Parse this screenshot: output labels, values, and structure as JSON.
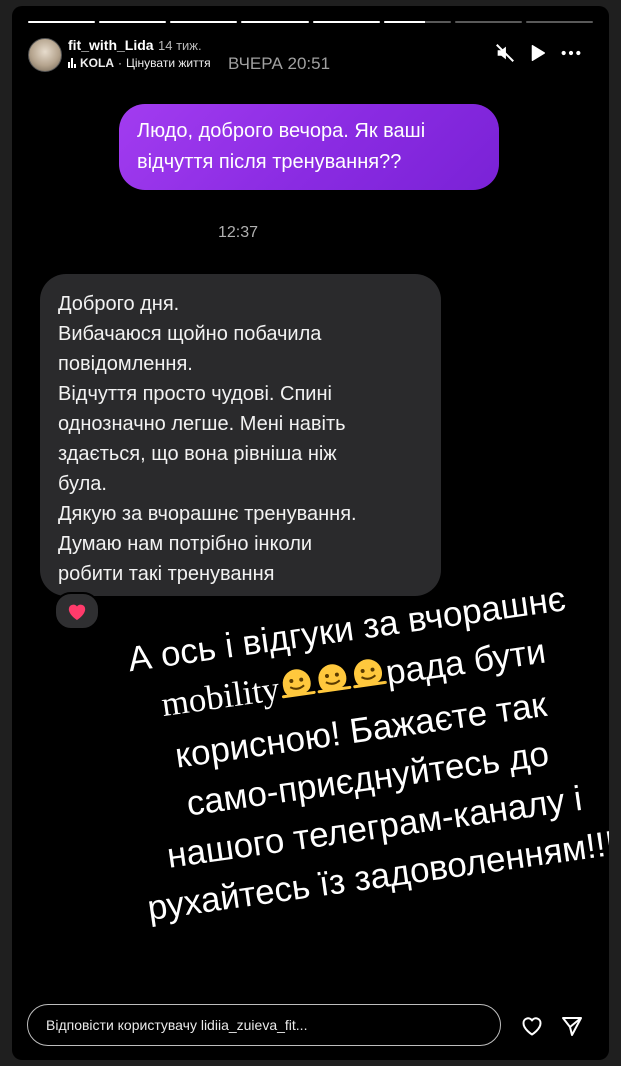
{
  "story": {
    "progress_segments": [
      1,
      1,
      1,
      1,
      1,
      0.62,
      0,
      0
    ],
    "username": "fit_with_Lida",
    "time_ago": "14 тиж.",
    "music": {
      "artist": "KOLA",
      "separator": "·",
      "song": "Цінувати життя"
    },
    "icons": {
      "mute": "muted-speaker-icon",
      "play": "play-icon",
      "more": "more-dots-icon"
    }
  },
  "chat": {
    "date_header": "ВЧЕРА 20:51",
    "outgoing": "Людо, доброго вечора.  Як ваші відчуття після тренування??",
    "time": "12:37",
    "incoming_lines": [
      "Доброго дня.",
      "Вибачаюся щойно побачила",
      "повідомлення.",
      "Відчуття просто чудові. Спині",
      "однозначно легше. Мені навіть",
      "здається, що вона рівніша ніж",
      "була.",
      "Дякую за вчорашнє тренування.",
      "Думаю нам потрібно інколи",
      "робити такі тренування"
    ],
    "reaction": "heart-reaction-icon"
  },
  "caption": {
    "line1": "А ось і відгуки за вчорашнє",
    "line2_word": "mobility",
    "line2_rest": "рада бути",
    "line3": "корисною! Бажаєте так",
    "line4": "само-приєднуйтесь до",
    "line5": "нашого телеграм-каналу і",
    "line6": "рухайтесь їз задоволенням!!!"
  },
  "footer": {
    "reply_placeholder": "Відповісти користувачу lidiia_zuieva_fit...",
    "icons": {
      "like": "heart-icon",
      "share": "send-icon"
    }
  }
}
